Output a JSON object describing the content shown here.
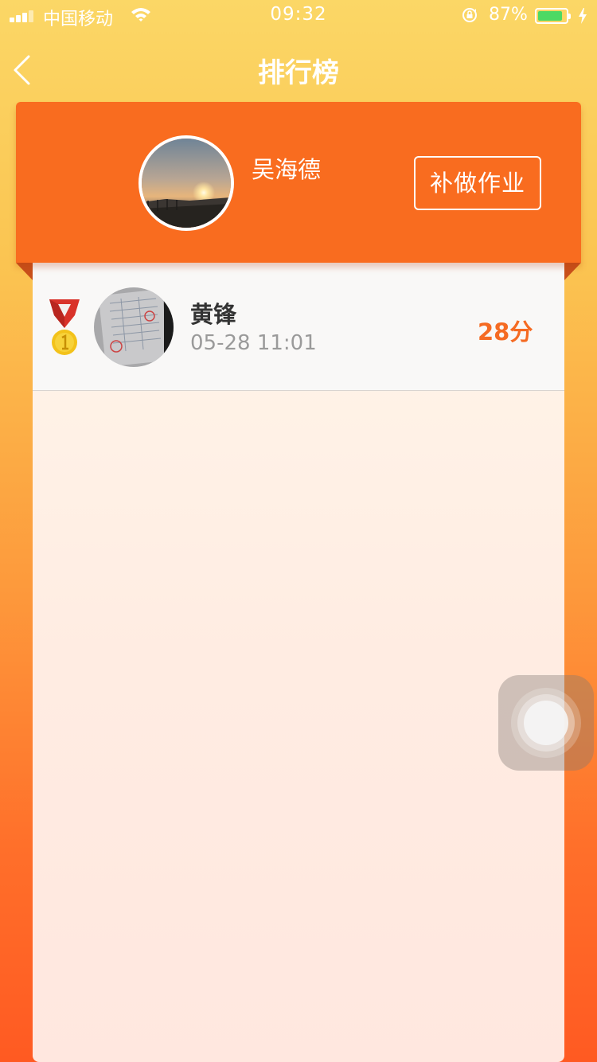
{
  "status_bar": {
    "carrier": "中国移动",
    "time": "09:32",
    "battery_percent": "87%",
    "battery_level": 0.87,
    "battery_color": "#4cd964",
    "icons": [
      "signal-icon",
      "wifi-icon",
      "orientation-lock-icon",
      "battery-icon",
      "charging-bolt-icon"
    ]
  },
  "nav": {
    "title": "排行榜",
    "back_icon": "chevron-left-icon"
  },
  "header": {
    "user_name": "吴海德",
    "avatar": "sunset-photo-avatar",
    "button_label": "补做作业"
  },
  "ranking": [
    {
      "rank": 1,
      "medal_icon": "gold-medal-icon",
      "avatar": "document-photo-avatar",
      "name": "黄锋",
      "time": "05-28 11:01",
      "score": "28分"
    }
  ],
  "colors": {
    "header_orange": "#f96c1f",
    "score_orange": "#f56b23",
    "background_top": "#fbd766",
    "background_bottom": "#ff5a22"
  },
  "overlay": {
    "icon": "assistive-touch-icon"
  }
}
